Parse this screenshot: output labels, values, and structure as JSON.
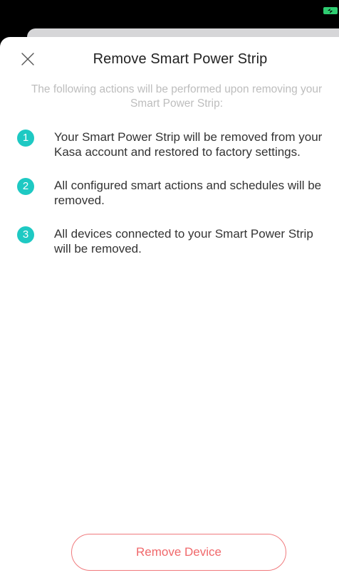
{
  "status_bar": {
    "battery_icon": "battery-charging-icon",
    "battery_color": "#2ecc71"
  },
  "header": {
    "close_icon": "close-icon",
    "title": "Remove Smart Power Strip"
  },
  "intro": {
    "text": "The following actions will be performed upon removing your Smart Power Strip:"
  },
  "steps": [
    {
      "number": "1",
      "text": "Your Smart Power Strip will be removed from your Kasa account and restored to factory settings."
    },
    {
      "number": "2",
      "text": "All configured smart actions and schedules will be removed."
    },
    {
      "number": "3",
      "text": "All devices connected to your Smart Power Strip will be removed."
    }
  ],
  "actions": {
    "remove_label": "Remove Device"
  },
  "colors": {
    "accent_teal": "#1ec9c3",
    "danger": "#f0686b",
    "title_text": "#222222",
    "muted_text": "#bdbdbd"
  }
}
